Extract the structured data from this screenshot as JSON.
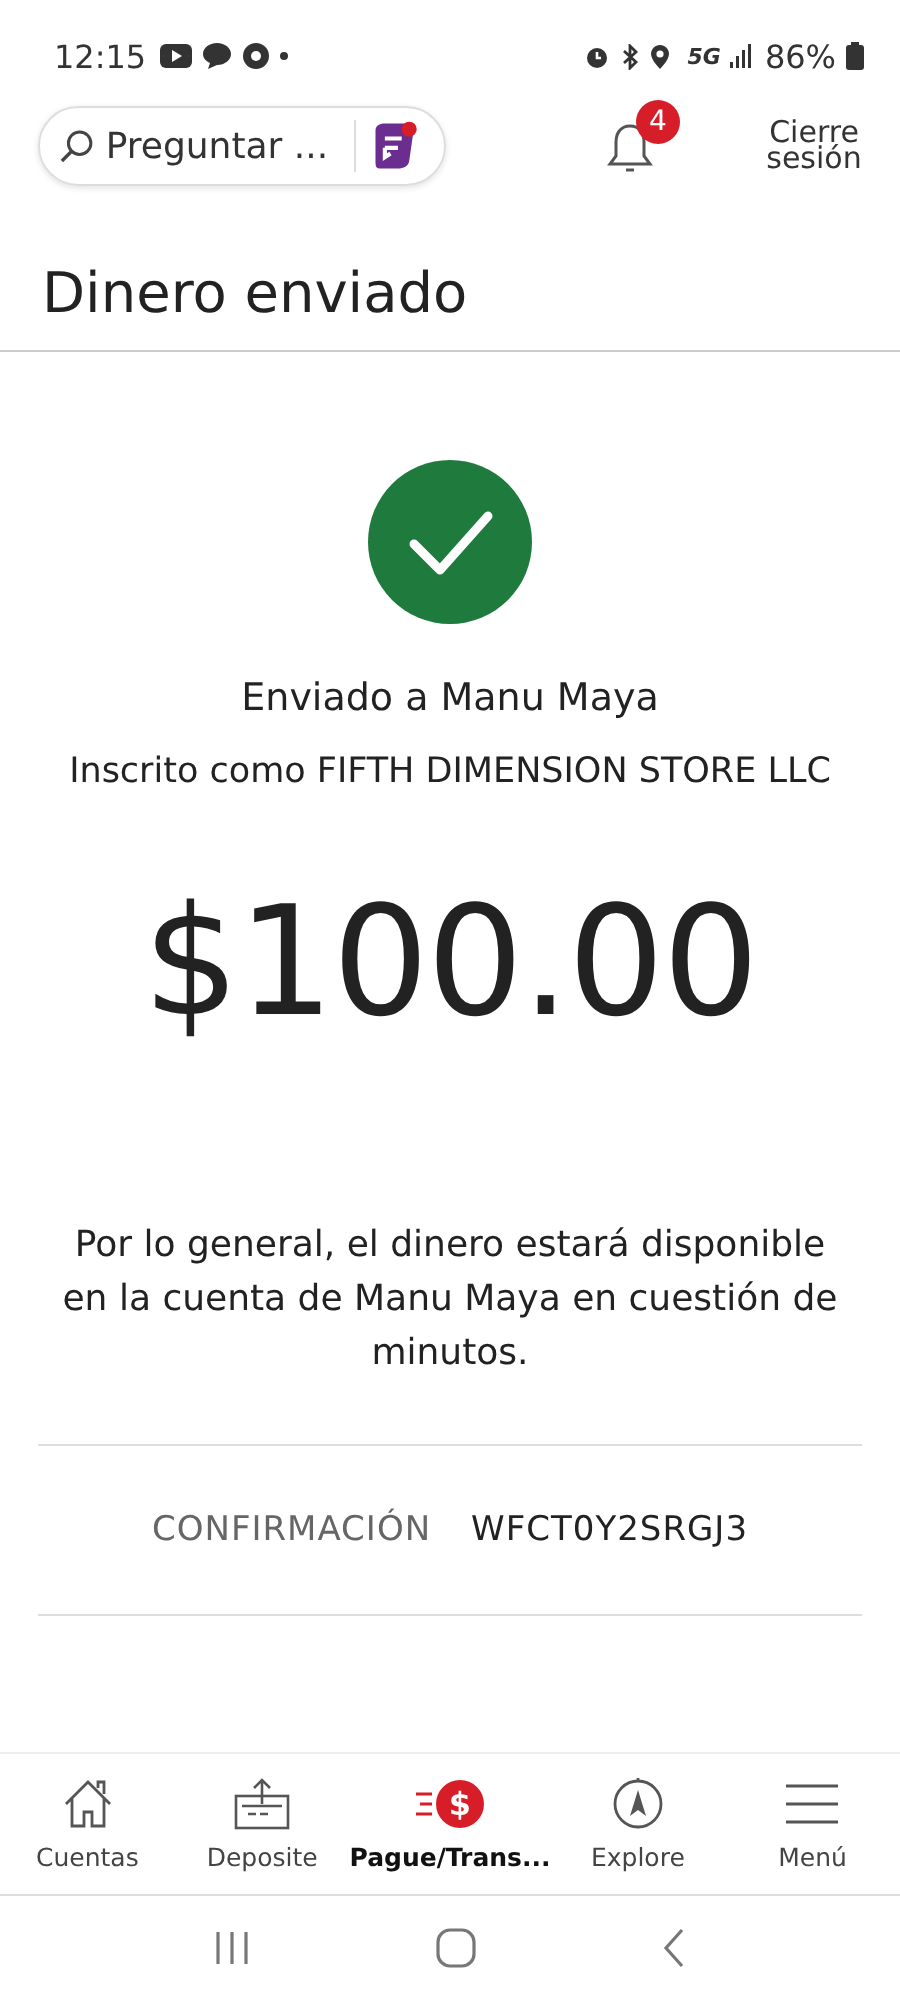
{
  "status_bar": {
    "time": "12:15",
    "network": "5G",
    "battery": "86%"
  },
  "header": {
    "search": {
      "placeholder": "Preguntar ..."
    },
    "notifications": {
      "count": "4"
    },
    "logout": "Cierre sesión"
  },
  "title": "Dinero enviado",
  "result": {
    "recipient": "Enviado a Manu Maya",
    "enrolled_as": "Inscrito como FIFTH DIMENSION STORE LLC",
    "amount": "$100.00",
    "message": "Por lo general, el dinero estará disponible en la cuenta de Manu Maya en cuestión de minutos."
  },
  "confirmation": {
    "label": "CONFIRMACIÓN",
    "code": "WFCT0Y2SRGJ3"
  },
  "bottom_nav": [
    {
      "kind": "home",
      "label": "Cuentas",
      "selected": false
    },
    {
      "kind": "deposit",
      "label": "Deposite",
      "selected": false
    },
    {
      "kind": "pay",
      "label": "Pague/Trans...",
      "icon_text": "$",
      "selected": true
    },
    {
      "kind": "explore",
      "label": "Explore",
      "selected": false
    },
    {
      "kind": "menu",
      "label": "Menú",
      "selected": false
    }
  ]
}
